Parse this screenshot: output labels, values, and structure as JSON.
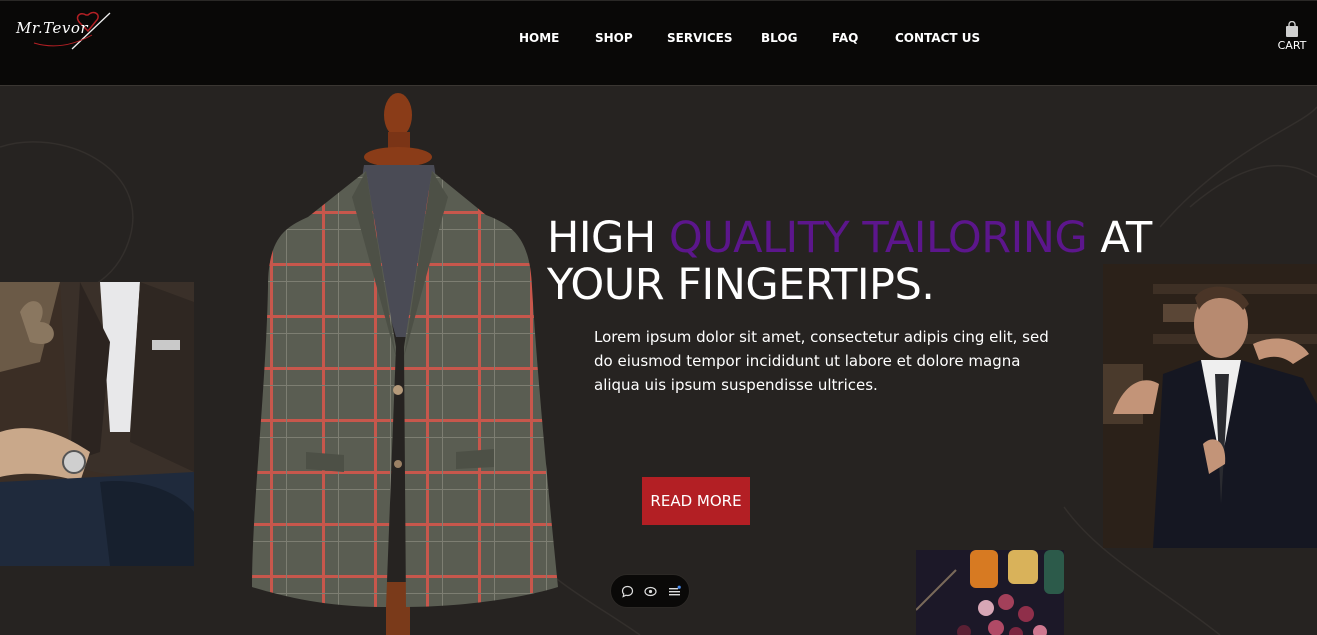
{
  "brand": {
    "logo_text": "Mr.Tevor"
  },
  "nav": {
    "items": [
      {
        "label": "HOME"
      },
      {
        "label": "SHOP"
      },
      {
        "label": "SERVICES"
      },
      {
        "label": "BLOG"
      },
      {
        "label": "FAQ"
      },
      {
        "label": "CONTACT US"
      }
    ],
    "cart_label": "CART"
  },
  "hero": {
    "headline_part1": "HIGH ",
    "headline_accent": "QUALITY TAILORING",
    "headline_part2": " AT YOUR FINGERTIPS.",
    "body": "Lorem ipsum dolor sit amet, consectetur adipis cing elit, sed do eiusmod tempor incididunt ut labore et dolore magna aliqua uis ipsum suspendisse ultrices.",
    "cta_label": "READ MORE"
  },
  "colors": {
    "accent": "#5c168c",
    "cta": "#b31f24",
    "nav_bg": "#090807",
    "hero_bg": "#262321"
  },
  "icons": {
    "cart": "shopping-bag-icon",
    "widget": [
      "chat-bubble-icon",
      "eye-icon",
      "menu-icon"
    ]
  }
}
